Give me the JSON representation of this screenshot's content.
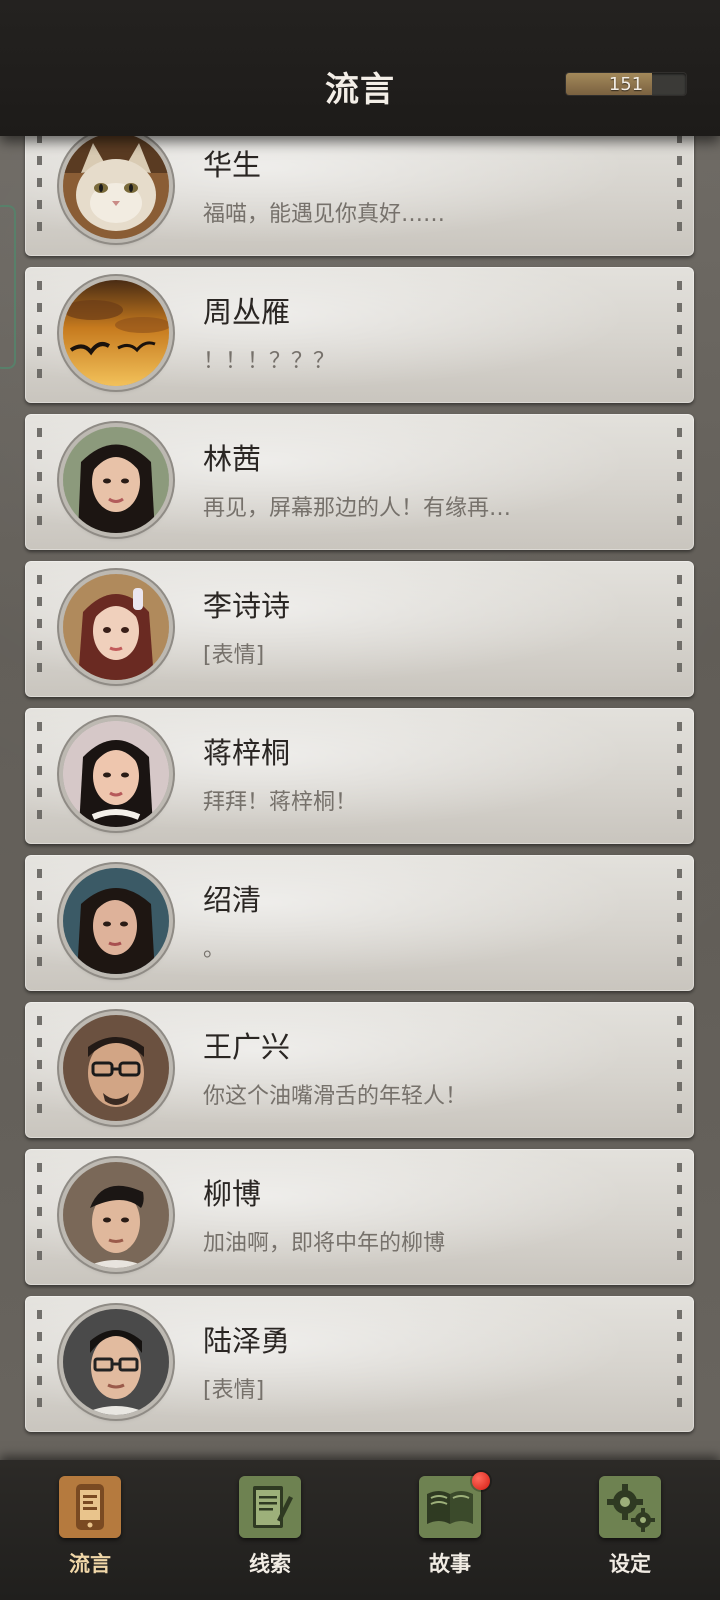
{
  "header": {
    "title": "流言",
    "counter_value": "151",
    "counter_fill_percent": 72
  },
  "conversations": [
    {
      "name": "华生",
      "last_message": "福喵，能遇见你真好……",
      "avatar_icon": "cat-avatar-icon"
    },
    {
      "name": "周丛雁",
      "last_message": "！！！？？？",
      "avatar_icon": "sunset-birds-avatar-icon"
    },
    {
      "name": "林茜",
      "last_message": "再见，屏幕那边的人！有缘再…",
      "avatar_icon": "woman-avatar-icon"
    },
    {
      "name": "李诗诗",
      "last_message": "[表情]",
      "avatar_icon": "woman-avatar-icon"
    },
    {
      "name": "蒋梓桐",
      "last_message": "拜拜！蒋梓桐！",
      "avatar_icon": "woman-avatar-icon"
    },
    {
      "name": "绍清",
      "last_message": "。",
      "avatar_icon": "woman-avatar-icon"
    },
    {
      "name": "王广兴",
      "last_message": "你这个油嘴滑舌的年轻人！",
      "avatar_icon": "man-glasses-avatar-icon"
    },
    {
      "name": "柳博",
      "last_message": "加油啊，即将中年的柳博",
      "avatar_icon": "man-avatar-icon"
    },
    {
      "name": "陆泽勇",
      "last_message": "[表情]",
      "avatar_icon": "man-glasses-avatar-icon"
    }
  ],
  "nav": [
    {
      "label": "流言",
      "icon": "rumor-phone-icon",
      "active": true
    },
    {
      "label": "线索",
      "icon": "notepad-icon",
      "active": false
    },
    {
      "label": "故事",
      "icon": "book-icon",
      "active": false,
      "badge": true
    },
    {
      "label": "设定",
      "icon": "gear-icon",
      "active": false
    }
  ],
  "colors": {
    "header_bg": "#1f1d1b",
    "card_bg": "#dcd9d3",
    "name_text": "#2a2623",
    "message_text": "#76716b",
    "counter_fill": "#8f754b",
    "badge_red": "#e02a1f",
    "nav_active_tile": "#b57a3e",
    "nav_tile": "#6e8251"
  }
}
